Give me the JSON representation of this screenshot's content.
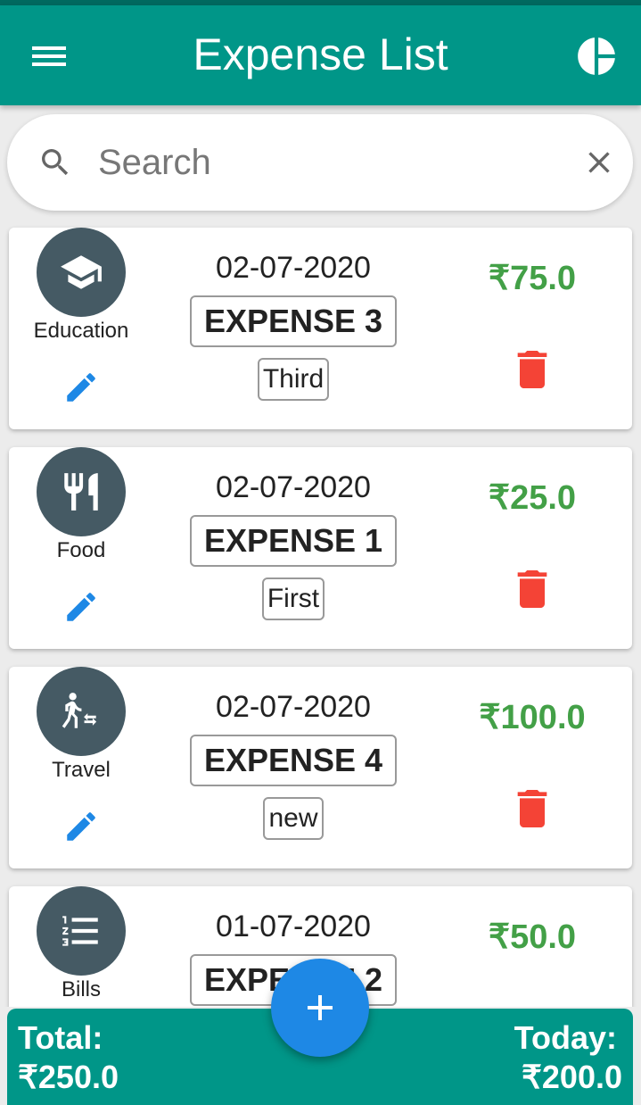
{
  "app": {
    "title": "Expense List"
  },
  "search": {
    "placeholder": "Search",
    "value": ""
  },
  "expenses": [
    {
      "category": "Education",
      "category_icon": "graduation-cap-icon",
      "date": "02-07-2020",
      "name": "EXPENSE 3",
      "tag": "Third",
      "amount": "₹75.0"
    },
    {
      "category": "Food",
      "category_icon": "fork-knife-icon",
      "date": "02-07-2020",
      "name": "EXPENSE 1",
      "tag": "First",
      "amount": "₹25.0"
    },
    {
      "category": "Travel",
      "category_icon": "traveler-icon",
      "date": "02-07-2020",
      "name": "EXPENSE 4",
      "tag": "new",
      "amount": "₹100.0"
    },
    {
      "category": "Bills",
      "category_icon": "list-icon",
      "date": "01-07-2020",
      "name": "EXPENSE 2",
      "tag": "",
      "amount": "₹50.0"
    }
  ],
  "summary": {
    "total_label": "Total:",
    "total_value": "₹250.0",
    "today_label": "Today:",
    "today_value": "₹200.0"
  },
  "colors": {
    "primary": "#009688",
    "amount": "#43a047",
    "delete": "#f44336",
    "edit": "#1e88e5",
    "fab": "#1e88e5",
    "category_circle": "#455a64"
  }
}
